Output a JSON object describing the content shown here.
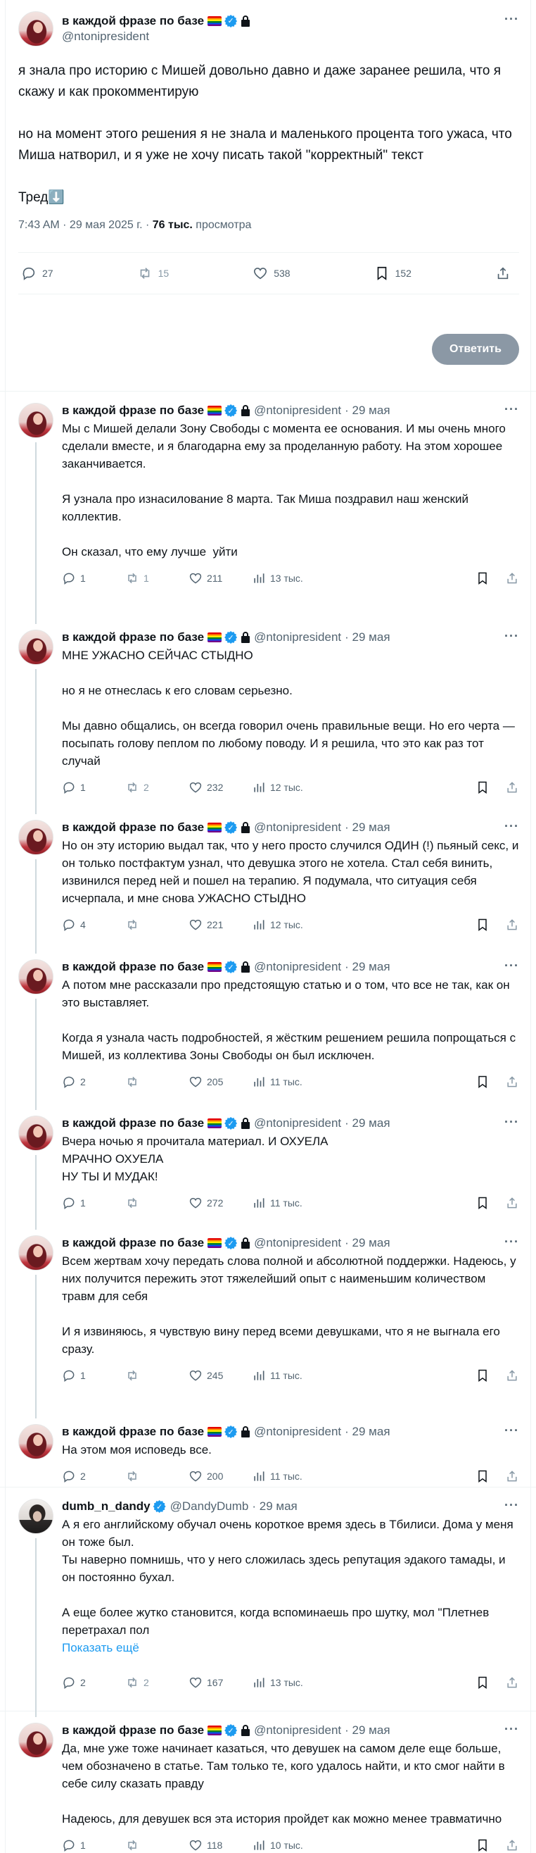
{
  "main": {
    "author_name": "в каждой фразе по базе",
    "author_handle": "@ntonipresident",
    "text": "я знала про историю с Мишей довольно давно и даже заранее решила, что я скажу и как прокомментирую\n\nно на момент этого решения я не знала и маленького процента того ужаса, что Миша натворил, и я уже не хочу писать такой \"корректный\" текст\n\nТред⬇️",
    "timestamp": "7:43 AM · 29 мая 2025 г. · ",
    "views_count": "76 тыс.",
    "views_label": " просмотра",
    "replies": "27",
    "reposts": "15",
    "likes": "538",
    "bookmarks": "152",
    "reply_button": "Ответить"
  },
  "replies": [
    {
      "name": "в каждой фразе по базе",
      "handle": "@ntonipresident",
      "date": "· 29 мая",
      "text": "Мы с Мишей делали Зону Свободы с момента ее основания. И мы очень много сделали вместе, и я благодарна ему за проделанную работу. На этом хорошее заканчивается.\n\nЯ узнала про изнасилование 8 марта. Так Миша поздравил наш женский коллектив.\n\nОн сказал, что ему лучше  уйти",
      "replies": "1",
      "reposts": "1",
      "likes": "211",
      "views": "13 тыс."
    },
    {
      "name": "в каждой фразе по базе",
      "handle": "@ntonipresident",
      "date": "· 29 мая",
      "text": "МНЕ УЖАСНО СЕЙЧАС СТЫДНО\n\nно я не отнеслась к его словам серьезно.\n\nМы давно общались, он всегда говорил очень правильные вещи. Но его черта — посыпать голову пеплом по любому поводу. И я решила, что это как раз тот случай",
      "replies": "1",
      "reposts": "2",
      "likes": "232",
      "views": "12 тыс."
    },
    {
      "name": "в каждой фразе по базе",
      "handle": "@ntonipresident",
      "date": "· 29 мая",
      "text": "Но он эту историю выдал так, что у него просто случился ОДИН (!) пьяный секс, и он только постфактум узнал, что девушка этого не хотела. Стал себя винить, извинился перед ней и пошел на терапию. Я подумала, что ситуация себя исчерпала, и мне снова УЖАСНО СТЫДНО",
      "replies": "4",
      "reposts": "",
      "likes": "221",
      "views": "12 тыс."
    },
    {
      "name": "в каждой фразе по базе",
      "handle": "@ntonipresident",
      "date": "· 29 мая",
      "text": "А потом мне рассказали про предстоящую статью и о том, что все не так, как он это выставляет.\n\nКогда я узнала часть подробностей, я жёстким решением решила попрощаться с Мишей, из коллектива Зоны Свободы он был исключен.",
      "replies": "2",
      "reposts": "",
      "likes": "205",
      "views": "11 тыс."
    },
    {
      "name": "в каждой фразе по базе",
      "handle": "@ntonipresident",
      "date": "· 29 мая",
      "text": "Вчера ночью я прочитала материал. И ОХУЕЛА\nМРАЧНО ОХУЕЛА\nНУ ТЫ И МУДАК!",
      "replies": "1",
      "reposts": "",
      "likes": "272",
      "views": "11 тыс."
    },
    {
      "name": "в каждой фразе по базе",
      "handle": "@ntonipresident",
      "date": "· 29 мая",
      "text": "Всем жертвам хочу передать слова полной и абсолютной поддержки. Надеюсь, у них получится пережить этот тяжелейший опыт с наименьшим количеством травм для себя\n\nИ я извиняюсь, я чувствую вину перед всеми девушками, что я не выгнала его сразу.",
      "replies": "1",
      "reposts": "",
      "likes": "245",
      "views": "11 тыс."
    },
    {
      "name": "в каждой фразе по базе",
      "handle": "@ntonipresident",
      "date": "· 29 мая",
      "text": "На этом моя исповедь все.",
      "replies": "2",
      "reposts": "",
      "likes": "200",
      "views": "11 тыс."
    },
    {
      "name": "dumb_n_dandy",
      "handle": "@DandyDumb",
      "date": "· 29 мая",
      "text": "А я его английскому обучал очень короткое время здесь в Тбилиси. Дома у меня он тоже был.\nТы наверно помнишь, что у него сложилась здесь репутация эдакого тамады, и он постоянно бухал.\n\nА еще более жутко становится, когда вспоминаешь про шутку, мол \"Плетнев перетрахал пол",
      "show_more": "Показать ещё",
      "replies": "2",
      "reposts": "2",
      "likes": "167",
      "views": "13 тыс."
    },
    {
      "name": "в каждой фразе по базе",
      "handle": "@ntonipresident",
      "date": "· 29 мая",
      "text": "Да, мне уже тоже начинает казаться, что девушек на самом деле еще больше, чем обозначено в статье. Там только те, кого удалось найти, и кто смог найти в себе силу сказать правду\n\nНадеюсь, для девушек вся эта история пройдет как можно менее травматично",
      "replies": "1",
      "reposts": "",
      "likes": "118",
      "views": "10 тыс."
    }
  ]
}
